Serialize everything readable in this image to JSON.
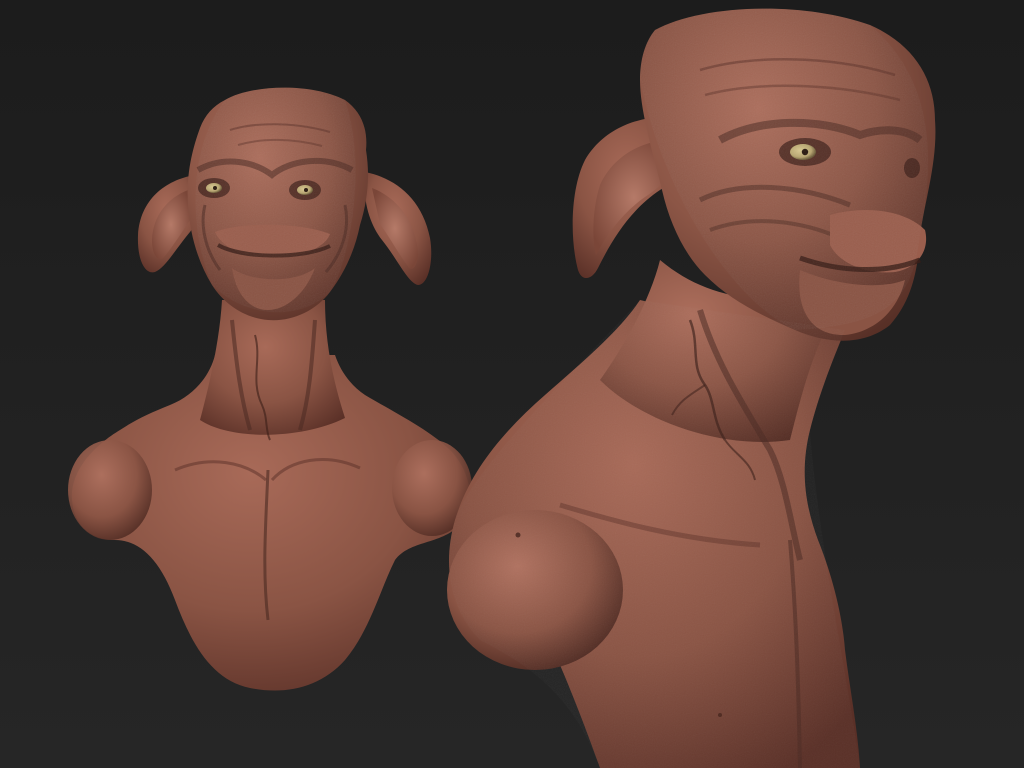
{
  "scene": {
    "description_label": "",
    "colors": {
      "background_top": "#1c1c1c",
      "background_bottom": "#262626",
      "skin_base": "#8a5444",
      "skin_light": "#a86a58",
      "skin_shadow": "#5a3027",
      "skin_deep": "#3a1e18",
      "vein": "#4a2a22",
      "eye_iris": "#b8a670",
      "eye_pupil": "#2a1a10"
    },
    "views": [
      {
        "id": "front-view",
        "subject": "creature-bust-front"
      },
      {
        "id": "three-quarter-view",
        "subject": "creature-bust-three-quarter"
      }
    ]
  }
}
